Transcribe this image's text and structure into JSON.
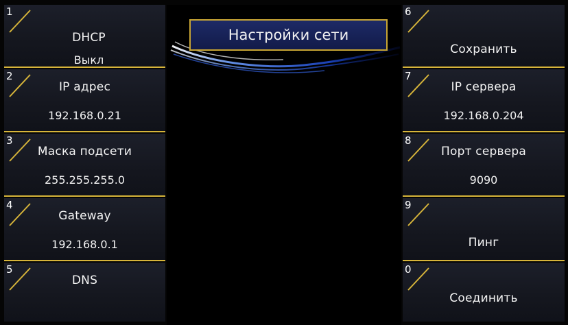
{
  "screen_title": "Настройки сети",
  "colors": {
    "accent": "#d7b53a",
    "tile_bg": "#1a1d27",
    "title_bg": "#1a2660",
    "wave": "#2f66ff"
  },
  "left_tiles": [
    {
      "num": "1",
      "label": "DHCP",
      "value": "Выкл"
    },
    {
      "num": "2",
      "label": "IP адрес",
      "value": "192.168.0.21"
    },
    {
      "num": "3",
      "label": "Маска подсети",
      "value": "255.255.255.0"
    },
    {
      "num": "4",
      "label": "Gateway",
      "value": "192.168.0.1"
    },
    {
      "num": "5",
      "label": "DNS"
    }
  ],
  "right_tiles": [
    {
      "num": "6",
      "label": "Сохранить"
    },
    {
      "num": "7",
      "label": "IP сервера",
      "value": "192.168.0.204"
    },
    {
      "num": "8",
      "label": "Порт сервера",
      "value": "9090"
    },
    {
      "num": "9",
      "label": "Пинг"
    },
    {
      "num": "0",
      "label": "Соединить"
    }
  ]
}
